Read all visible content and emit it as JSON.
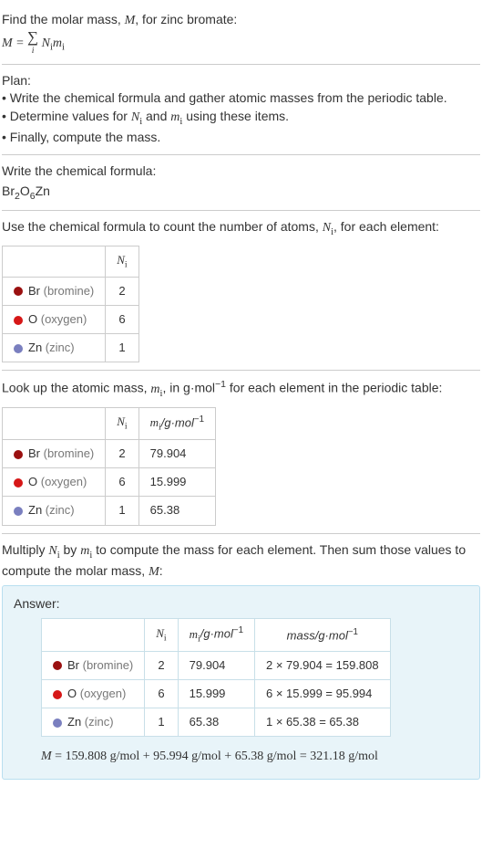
{
  "intro": {
    "line1_a": "Find the molar mass, ",
    "line1_b": ", for zinc bromate:",
    "eq_lhs": "M",
    "eq_eq": " = ",
    "sum_sym": "∑",
    "sum_idx": "i",
    "eq_rhs_N": "N",
    "eq_rhs_Ni": "i",
    "eq_rhs_m": "m",
    "eq_rhs_mi": "i"
  },
  "plan": {
    "heading": "Plan:",
    "b1": "• Write the chemical formula and gather atomic masses from the periodic table.",
    "b2_a": "• Determine values for ",
    "b2_b": " and ",
    "b2_c": " using these items.",
    "b3": "• Finally, compute the mass."
  },
  "chem": {
    "heading": "Write the chemical formula:",
    "f_br": "Br",
    "f_br_n": "2",
    "f_o": "O",
    "f_o_n": "6",
    "f_zn": "Zn"
  },
  "count": {
    "heading_a": "Use the chemical formula to count the number of atoms, ",
    "heading_b": ", for each element:",
    "hdr_N": "N",
    "hdr_Ni": "i",
    "rows": [
      {
        "sym": "Br",
        "name": "(bromine)",
        "dot": "dot-br",
        "n": "2"
      },
      {
        "sym": "O",
        "name": "(oxygen)",
        "dot": "dot-o",
        "n": "6"
      },
      {
        "sym": "Zn",
        "name": "(zinc)",
        "dot": "dot-zn",
        "n": "1"
      }
    ]
  },
  "mass": {
    "heading_a": "Look up the atomic mass, ",
    "heading_b": ", in g·mol",
    "heading_c": " for each element in the periodic table:",
    "exp": "−1",
    "hdr_m": "m",
    "hdr_mi": "i",
    "unit_a": "/g·mol",
    "rows": [
      {
        "sym": "Br",
        "name": "(bromine)",
        "dot": "dot-br",
        "n": "2",
        "m": "79.904"
      },
      {
        "sym": "O",
        "name": "(oxygen)",
        "dot": "dot-o",
        "n": "6",
        "m": "15.999"
      },
      {
        "sym": "Zn",
        "name": "(zinc)",
        "dot": "dot-zn",
        "n": "1",
        "m": "65.38"
      }
    ]
  },
  "mult": {
    "heading_a": "Multiply ",
    "heading_b": " by ",
    "heading_c": " to compute the mass for each element. Then sum those values to compute the molar mass, ",
    "heading_d": ":"
  },
  "answer": {
    "label": "Answer:",
    "hdr_mass": "mass/g·mol",
    "rows": [
      {
        "sym": "Br",
        "name": "(bromine)",
        "dot": "dot-br",
        "n": "2",
        "m": "79.904",
        "calc": "2 × 79.904 = 159.808"
      },
      {
        "sym": "O",
        "name": "(oxygen)",
        "dot": "dot-o",
        "n": "6",
        "m": "15.999",
        "calc": "6 × 15.999 = 95.994"
      },
      {
        "sym": "Zn",
        "name": "(zinc)",
        "dot": "dot-zn",
        "n": "1",
        "m": "65.38",
        "calc": "1 × 65.38 = 65.38"
      }
    ],
    "final_a": "M",
    "final_b": " = 159.808 g/mol + 95.994 g/mol + 65.38 g/mol = 321.18 g/mol"
  },
  "sym": {
    "N": "N",
    "i": "i",
    "m": "m",
    "M": "M"
  }
}
